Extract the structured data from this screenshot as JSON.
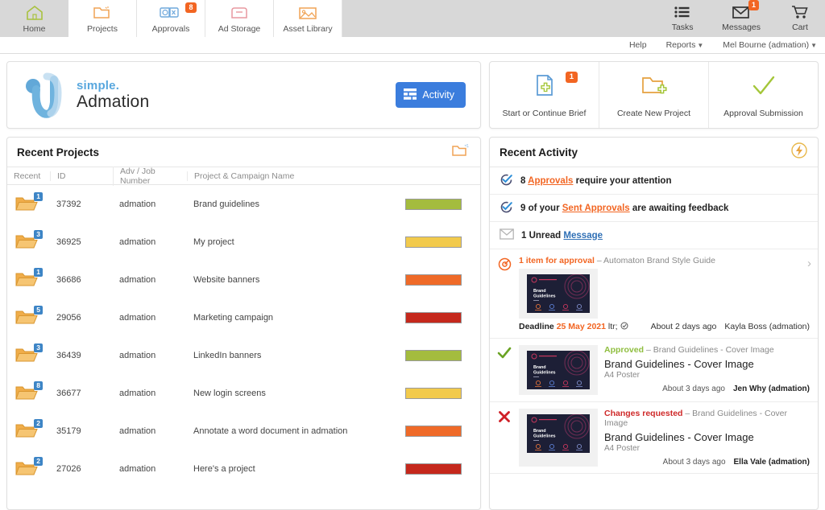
{
  "topnav": {
    "tabs": [
      {
        "label": "Home",
        "icon": "home-icon",
        "active": true,
        "badge": ""
      },
      {
        "label": "Projects",
        "icon": "folder-open-icon",
        "active": false,
        "badge": ""
      },
      {
        "label": "Approvals",
        "icon": "approvals-icon",
        "active": false,
        "badge": "8"
      },
      {
        "label": "Ad Storage",
        "icon": "archive-box-icon",
        "active": false,
        "badge": ""
      },
      {
        "label": "Asset Library",
        "icon": "image-icon",
        "active": false,
        "badge": ""
      }
    ],
    "right_items": [
      {
        "label": "Tasks",
        "icon": "tasks-list-icon",
        "badge": ""
      },
      {
        "label": "Messages",
        "icon": "envelope-icon",
        "badge": "1"
      },
      {
        "label": "Cart",
        "icon": "shopping-cart-icon",
        "badge": ""
      }
    ]
  },
  "subbar": {
    "help": "Help",
    "reports": "Reports",
    "user": "Mel Bourne (admation)"
  },
  "brand": {
    "line1": "simple.",
    "line2": "Admation",
    "activity_button": "Activity",
    "accent_blue": "#3b7ddd",
    "logo_blue": "#58a7de"
  },
  "quick_actions": [
    {
      "label": "Start or Continue Brief",
      "icon": "document-add-icon",
      "badge": "1"
    },
    {
      "label": "Create New Project",
      "icon": "folder-add-icon",
      "badge": ""
    },
    {
      "label": "Approval Submission",
      "icon": "green-check-icon",
      "badge": ""
    }
  ],
  "recent_projects": {
    "title": "Recent Projects",
    "header_icon": "folder-open-shine-icon",
    "columns": [
      "Recent",
      "ID",
      "Adv / Job Number",
      "Project & Campaign Name"
    ],
    "rows": [
      {
        "badge": "1",
        "id": "37392",
        "adv": "admation",
        "name": "Brand guidelines",
        "status_color": "#a4bc3e"
      },
      {
        "badge": "3",
        "id": "36925",
        "adv": "admation",
        "name": "My project",
        "status_color": "#f2ca4c"
      },
      {
        "badge": "1",
        "id": "36686",
        "adv": "admation",
        "name": "Website banners",
        "status_color": "#ef6a28"
      },
      {
        "badge": "5",
        "id": "29056",
        "adv": "admation",
        "name": "Marketing campaign",
        "status_color": "#c5281c"
      },
      {
        "badge": "3",
        "id": "36439",
        "adv": "admation",
        "name": "LinkedIn banners",
        "status_color": "#a4bc3e"
      },
      {
        "badge": "8",
        "id": "36677",
        "adv": "admation",
        "name": "New login screens",
        "status_color": "#f2ca4c"
      },
      {
        "badge": "2",
        "id": "35179",
        "adv": "admation",
        "name": "Annotate a word document in admation",
        "status_color": "#ef6a28"
      },
      {
        "badge": "2",
        "id": "27026",
        "adv": "admation",
        "name": "Here's a project",
        "status_color": "#c5281c"
      }
    ]
  },
  "recent_activity": {
    "title": "Recent Activity",
    "header_icon": "lightning-bolt-icon",
    "summary_rows": [
      {
        "icon": "check-circle-icon",
        "count": "8",
        "link": "Approvals",
        "before": "8 ",
        "after": " require your attention",
        "link_style": "orange"
      },
      {
        "icon": "check-circle-icon",
        "count": "9",
        "link": "Sent Approvals",
        "before": "9 of your ",
        "after": " are awaiting feedback",
        "link_style": "orange"
      },
      {
        "icon": "envelope-outline-icon",
        "count": "1",
        "link": "Message",
        "before": "1 Unread ",
        "after": "",
        "link_style": "blue"
      }
    ],
    "cards": [
      {
        "status_icon": "orange-target-icon",
        "status_text": "1 item for approval",
        "status_color": "orange",
        "headline_rest": "– Automaton Brand Style Guide",
        "thumb_title": "Brand Guidelines",
        "title": "",
        "subtitle": "",
        "deadline_label": "Deadline",
        "deadline_date": "25 May 2021",
        "time_ago": "About 2 days ago",
        "user": "Kayla Boss (admation)",
        "chevron": "›"
      },
      {
        "status_icon": "green-check-icon",
        "status_text": "Approved",
        "status_color": "green",
        "headline_rest": "– Brand Guidelines - Cover Image",
        "thumb_title": "Brand Guidelines",
        "title": "Brand Guidelines - Cover Image",
        "subtitle": "A4 Poster",
        "deadline_label": "",
        "deadline_date": "",
        "time_ago": "About 3 days ago",
        "user": "Jen Why (admation)",
        "chevron": ""
      },
      {
        "status_icon": "red-cross-icon",
        "status_text": "Changes requested",
        "status_color": "red",
        "headline_rest": "– Brand Guidelines - Cover Image",
        "thumb_title": "Brand Guidelines",
        "title": "Brand Guidelines - Cover Image",
        "subtitle": "A4 Poster",
        "deadline_label": "",
        "deadline_date": "",
        "time_ago": "About 3 days ago",
        "user": "Ella Vale (admation)",
        "chevron": ""
      }
    ]
  }
}
